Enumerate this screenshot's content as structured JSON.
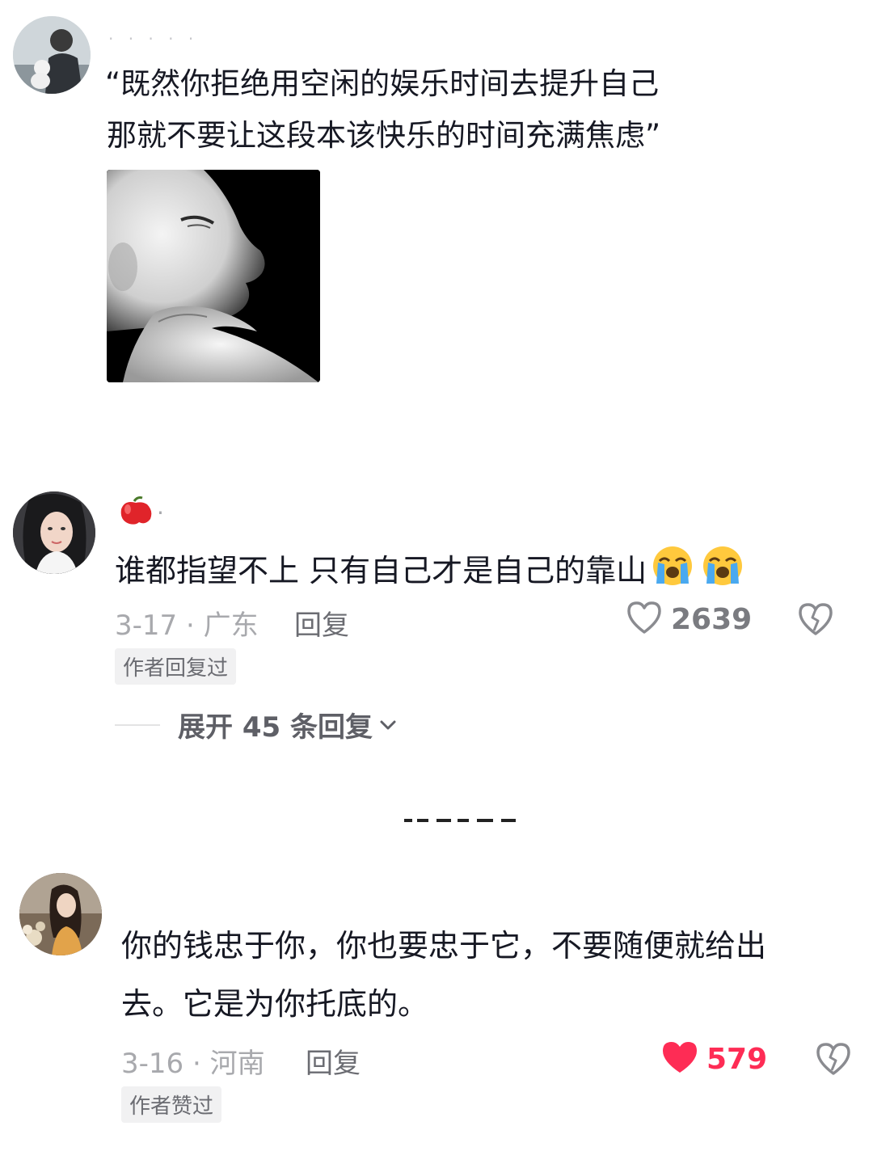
{
  "post": {
    "author_name_masked": "· · · · ·",
    "quote_lines": [
      "“既然你拒绝用空闲的娱乐时间去提升自己",
      "那就不要让这段本该快乐的时间充满焦虑”"
    ],
    "image_description_icon": "baby-profile-photo"
  },
  "comments": [
    {
      "username": "·",
      "username_icon": "apple-emoji",
      "text": "谁都指望不上 只有自己才是自己的靠山",
      "text_emojis": [
        "loudly-crying-face-icon",
        "loudly-crying-face-icon"
      ],
      "date_location": "3-17 · 广东",
      "reply_label": "回复",
      "like_count": "2639",
      "liked": false,
      "badge": "作者回复过",
      "expand_label": "展开 45 条回复"
    },
    {
      "username": "",
      "text_line1": "你的钱忠于你，你也要忠于它，不要随便就给出",
      "text_line2": "去。它是为你托底的。",
      "date_location": "3-16 · 河南",
      "reply_label": "回复",
      "like_count": "579",
      "liked": true,
      "badge": "作者赞过"
    }
  ],
  "colors": {
    "text": "#161823",
    "meta_gray": "#a8a9ad",
    "like_red": "#fe2c55",
    "badge_bg": "#f1f1f2"
  }
}
